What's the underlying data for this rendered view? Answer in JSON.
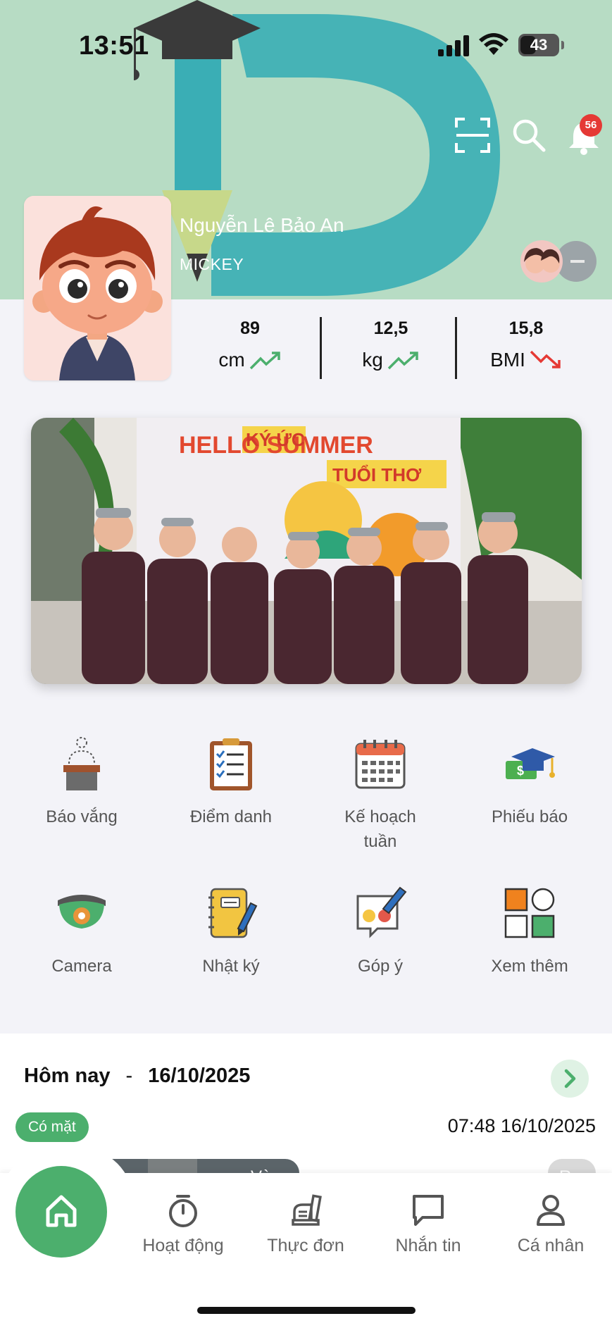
{
  "status_bar": {
    "time": "13:51",
    "battery": "43",
    "battery_level": 0.43
  },
  "header": {
    "notification_count": "56"
  },
  "student": {
    "name": "Nguyễn Lê Bảo An",
    "class": "MICKEY"
  },
  "stats": [
    {
      "value": "89",
      "unit": "cm",
      "trend": "up"
    },
    {
      "value": "12,5",
      "unit": "kg",
      "trend": "up"
    },
    {
      "value": "15,8",
      "unit": "BMI",
      "trend": "down"
    }
  ],
  "banner": {
    "line1": "HELLO SUMMER",
    "line2": "KÝ ỨC",
    "line3": "TUỔI THƠ"
  },
  "menu": [
    {
      "label": "Báo vắng",
      "icon": "absence-icon"
    },
    {
      "label": "Điểm danh",
      "icon": "attendance-clipboard-icon"
    },
    {
      "label": "Kế hoạch tuần",
      "icon": "calendar-icon"
    },
    {
      "label": "Phiếu báo",
      "icon": "tuition-notice-icon"
    },
    {
      "label": "Camera",
      "icon": "camera-icon"
    },
    {
      "label": "Nhật ký",
      "icon": "diary-icon"
    },
    {
      "label": "Góp ý",
      "icon": "feedback-icon"
    },
    {
      "label": "Xem thêm",
      "icon": "more-grid-icon"
    }
  ],
  "today": {
    "label": "Hôm nay",
    "separator": "-",
    "date": "16/10/2025",
    "status": "Có mặt",
    "checkin_time": "07:48 16/10/2025",
    "card_left_label": "Vào",
    "card_right_label": "Ra"
  },
  "bottom_nav": [
    {
      "label": "Hoạt động",
      "icon": "timer-icon"
    },
    {
      "label": "Thực đơn",
      "icon": "food-tray-icon"
    },
    {
      "label": "Nhắn tin",
      "icon": "chat-icon"
    },
    {
      "label": "Cá nhân",
      "icon": "user-icon"
    }
  ],
  "colors": {
    "primary": "#4caf6d",
    "header_bg": "#b7dcc4",
    "logo_teal": "#3aaeb5",
    "badge_red": "#e53935"
  }
}
